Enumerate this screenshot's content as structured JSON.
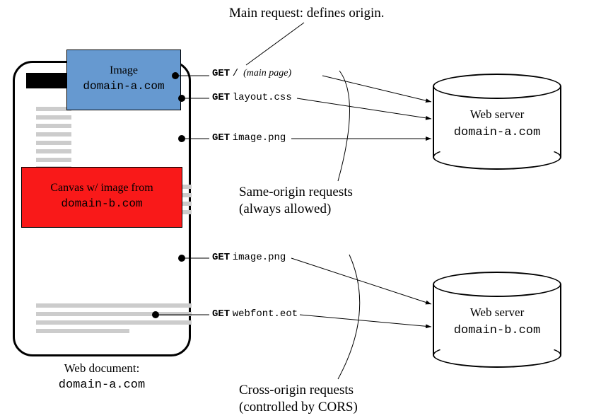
{
  "annotations": {
    "top": "Main request: defines origin.",
    "same": "Same-origin requests\n(always allowed)",
    "cross": "Cross-origin requests\n(controlled by CORS)"
  },
  "webdoc": {
    "caption_l1": "Web document:",
    "caption_l2": "domain-a.com",
    "image_l1": "Image",
    "image_l2": "domain-a.com",
    "canvas_l1": "Canvas w/ image from",
    "canvas_l2": "domain-b.com"
  },
  "server_a": {
    "title": "Web server",
    "host": "domain-a.com"
  },
  "server_b": {
    "title": "Web server",
    "host": "domain-b.com"
  },
  "requests": {
    "r1": {
      "verb": "GET",
      "path": "/",
      "note": "(main page)"
    },
    "r2": {
      "verb": "GET",
      "path": "layout.css",
      "note": ""
    },
    "r3": {
      "verb": "GET",
      "path": "image.png",
      "note": ""
    },
    "r4": {
      "verb": "GET",
      "path": "image.png",
      "note": ""
    },
    "r5": {
      "verb": "GET",
      "path": "webfont.eot",
      "note": ""
    }
  }
}
